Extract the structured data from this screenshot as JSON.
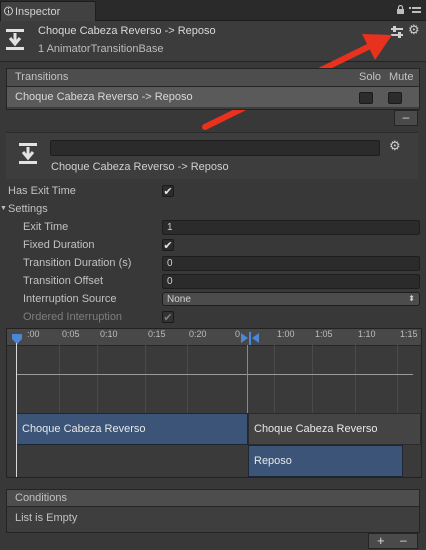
{
  "window": {
    "tab_label": "Inspector"
  },
  "header": {
    "title": "Choque Cabeza Reverso -> Reposo",
    "subtitle": "1 AnimatorTransitionBase"
  },
  "transitions": {
    "header": "Transitions",
    "solo_label": "Solo",
    "mute_label": "Mute",
    "items": [
      {
        "name": "Choque Cabeza Reverso -> Reposo",
        "solo": false,
        "mute": false
      }
    ],
    "remove_label": "–"
  },
  "transition": {
    "name_value": "",
    "caption": "Choque Cabeza Reverso -> Reposo",
    "has_exit_time_label": "Has Exit Time",
    "has_exit_time": true,
    "settings_label": "Settings",
    "exit_time_label": "Exit Time",
    "exit_time": "1",
    "fixed_duration_label": "Fixed Duration",
    "fixed_duration": true,
    "duration_label": "Transition Duration (s)",
    "duration": "0",
    "offset_label": "Transition Offset",
    "offset": "0",
    "interruption_label": "Interruption Source",
    "interruption": "None",
    "ordered_label": "Ordered Interruption",
    "ordered": true
  },
  "timeline": {
    "ticks": [
      ":00",
      "0:05",
      "0:10",
      "0:15",
      "0:20",
      "0",
      "1:00",
      "1:05",
      "1:10",
      "1:15"
    ],
    "source_state": "Choque Cabeza Reverso",
    "target_state_top": "Choque Cabeza Reverso",
    "target_state": "Reposo"
  },
  "conditions": {
    "header": "Conditions",
    "empty_text": "List is Empty",
    "add_label": "+",
    "remove_label": "–"
  },
  "colors": {
    "state_block": "#3b5478",
    "arrow": "#e8321e"
  }
}
